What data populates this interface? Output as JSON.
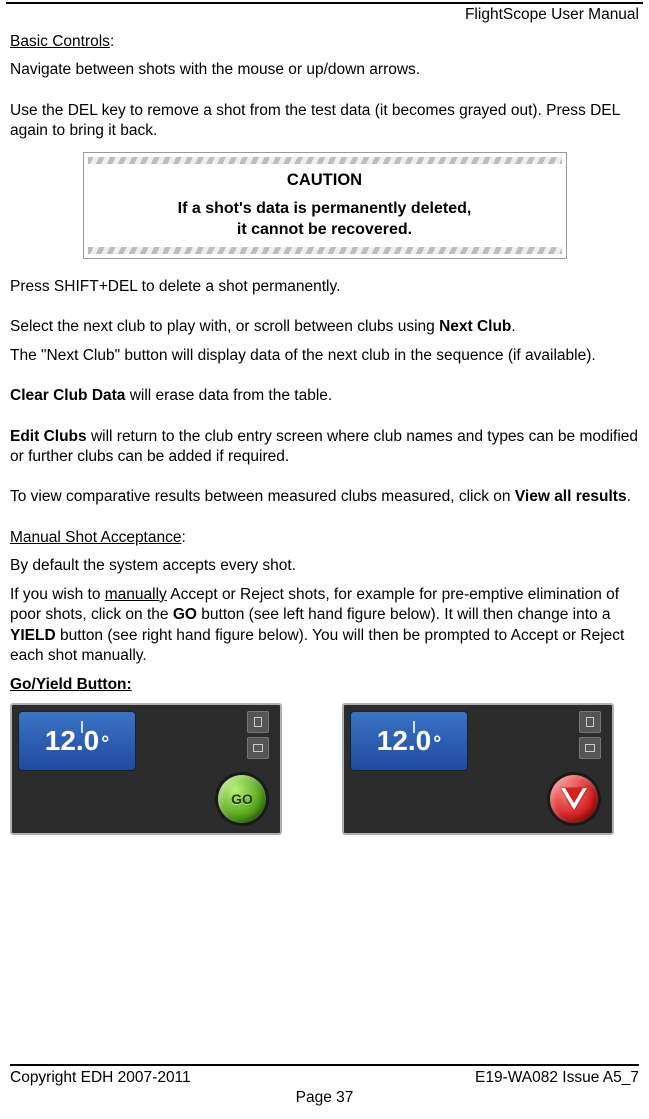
{
  "header": {
    "title_right": "FlightScope User Manual"
  },
  "sections": {
    "basic_controls": {
      "heading": "Basic Controls",
      "colon": ":",
      "p1": "Navigate between shots with the mouse or up/down arrows.",
      "p2": "Use the DEL key to remove a shot from the test data (it becomes grayed out). Press DEL again to bring it back."
    },
    "caution": {
      "title": "CAUTION",
      "line1": "If a shot's data is permanently deleted,",
      "line2": "it cannot be recovered."
    },
    "after_caution": {
      "p1": "Press SHIFT+DEL to delete a shot permanently.",
      "p2a": "Select the next club to play with, or scroll between clubs using ",
      "p2b_bold": "Next Club",
      "p2c": ".",
      "p3": "The \"Next Club\" button will display data of the next club in the sequence (if available).",
      "p4a_bold": "Clear Club Data",
      "p4b": " will erase data from the table.",
      "p5a_bold": "Edit Clubs",
      "p5b": " will return to the club entry screen where club names and types can be modified or further clubs can be added if required.",
      "p6a": "To view comparative results between measured clubs measured, click on ",
      "p6b_bold": "View all results",
      "p6c": "."
    },
    "manual_shot": {
      "heading": "Manual Shot Acceptance",
      "colon": ":",
      "p1": "By default the system accepts every shot.",
      "p2a": "If you wish to ",
      "p2b_u": "manually",
      "p2c": " Accept or Reject shots, for example for pre-emptive elimination of poor shots, click on the ",
      "p2d_bold": "GO",
      "p2e": " button (see left hand figure below). It will then change into a ",
      "p2f_bold": "YIELD",
      "p2g": " button (see right hand figure below). You will then be prompted to Accept or Reject each shot manually."
    },
    "go_yield": {
      "heading": "Go/Yield Button:",
      "value": "12.0",
      "deg": "°",
      "go_label": "GO"
    }
  },
  "footer": {
    "left": "Copyright EDH 2007-2011",
    "right": "E19-WA082 Issue A5_7",
    "center": "Page 37"
  }
}
